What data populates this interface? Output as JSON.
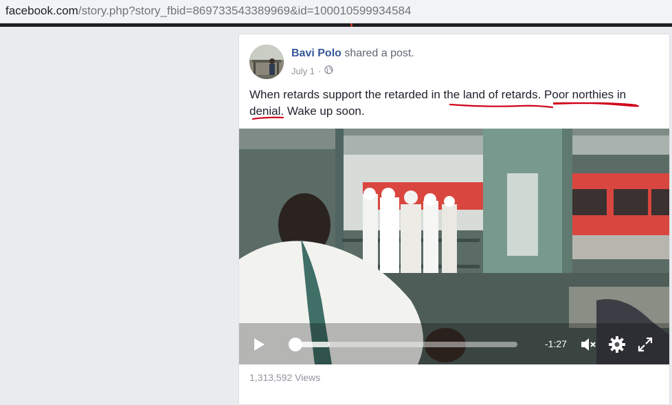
{
  "browser": {
    "url_domain": "facebook.com",
    "url_rest": "/story.php?story_fbid=869733543389969&id=100010599934584"
  },
  "post": {
    "author": "Bavi Polo",
    "action": " shared a post.",
    "date": "July 1",
    "separator": "·",
    "text_part1": "When retards support the retarded in ",
    "text_part2": "the land of retards",
    "text_part3": ". ",
    "text_part4": "Poor northies in denial",
    "text_part5": ". Wake up soon.",
    "views": "1,313,592 Views"
  },
  "video": {
    "time_remaining": "-1:27",
    "progress_fraction": 0.03
  },
  "colors": {
    "link": "#365899",
    "annotation": "#d0021b",
    "train": "#d9463f"
  },
  "icons": [
    "globe-icon",
    "play-icon",
    "mute-icon",
    "settings-icon",
    "fullscreen-icon"
  ]
}
